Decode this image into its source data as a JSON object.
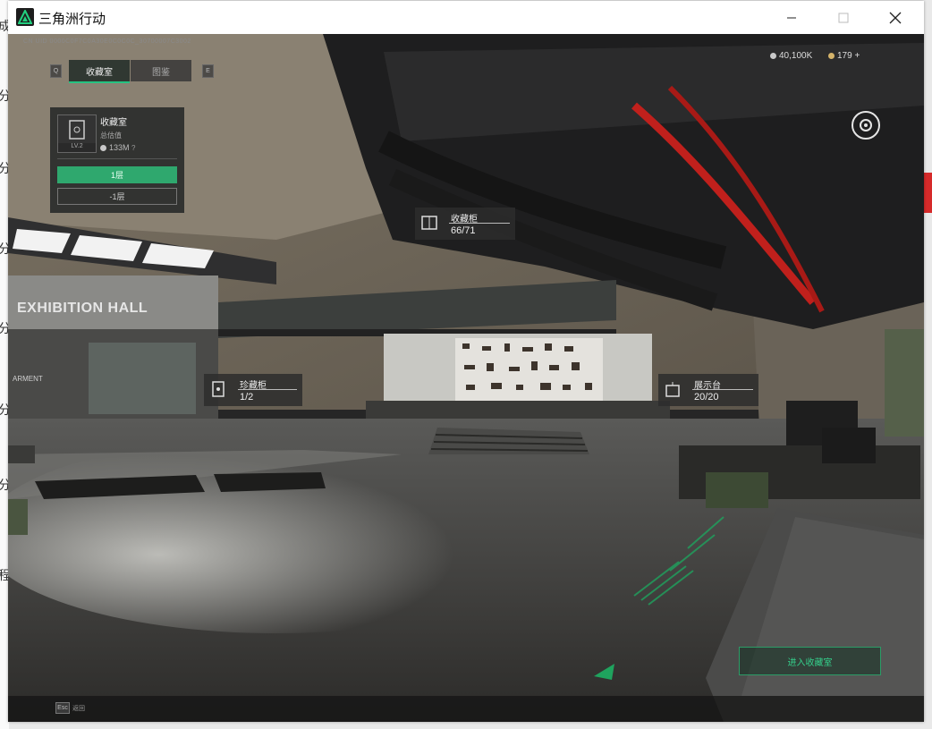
{
  "window": {
    "title": "三角洲行动"
  },
  "hud": {
    "uid": "CN UID 0000C0F7C0A30E0C0C0C_30700007C3002",
    "tabs": [
      "收藏室",
      "图鉴"
    ],
    "currency1": "40,100K",
    "currency2": "179 +"
  },
  "room_panel": {
    "name": "收藏室",
    "level": "LV.2",
    "subtitle": "总估值",
    "value": "133M",
    "floors": [
      "1层",
      "-1层"
    ]
  },
  "labels": [
    {
      "name": "收藏柜",
      "value": "66/71"
    },
    {
      "name": "珍藏柜",
      "value": "1/2"
    },
    {
      "name": "展示台",
      "value": "20/20"
    }
  ],
  "scene_text": {
    "hall": "EXHIBITION HALL",
    "wall": "ARMENT"
  },
  "enter_button": "进入收藏室",
  "bottom": {
    "esc_key": "Esc",
    "esc_label": "返回"
  },
  "colors": {
    "accent": "#25c281",
    "pipe": "#c0201c"
  }
}
